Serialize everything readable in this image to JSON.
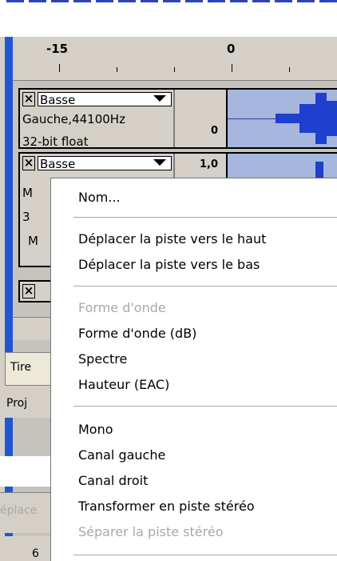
{
  "ruler": {
    "labels": [
      "-15",
      "0"
    ]
  },
  "tracks": [
    {
      "name": "Basse",
      "info_line1": "Gauche,44100Hz",
      "info_line2": "32-bit float",
      "scale_value": "0"
    },
    {
      "name": "Basse",
      "info_line1": "M",
      "info_line2": "3",
      "info_line3": "M",
      "scale_value": "1,0"
    }
  ],
  "left_fragments": {
    "tire": "Tire",
    "proj": "Proj",
    "eplac": "éplace",
    "six": "6"
  },
  "context_menu": {
    "groups": [
      [
        {
          "label": "Nom...",
          "enabled": true
        }
      ],
      [
        {
          "label": "Déplacer la piste vers le haut",
          "enabled": true
        },
        {
          "label": "Déplacer la piste vers le bas",
          "enabled": true
        }
      ],
      [
        {
          "label": "Forme d'onde",
          "enabled": false
        },
        {
          "label": "Forme d'onde (dB)",
          "enabled": true
        },
        {
          "label": "Spectre",
          "enabled": true
        },
        {
          "label": "Hauteur (EAC)",
          "enabled": true
        }
      ],
      [
        {
          "label": "Mono",
          "enabled": true
        },
        {
          "label": "Canal gauche",
          "enabled": true
        },
        {
          "label": "Canal droit",
          "enabled": true
        },
        {
          "label": "Transformer en piste stéréo",
          "enabled": true
        },
        {
          "label": "Séparer la piste stéréo",
          "enabled": false
        }
      ]
    ]
  },
  "colors": {
    "window_border": "#1f57d3",
    "waveform_bg": "#a6b6dc",
    "waveform": "#1f3fcf"
  }
}
